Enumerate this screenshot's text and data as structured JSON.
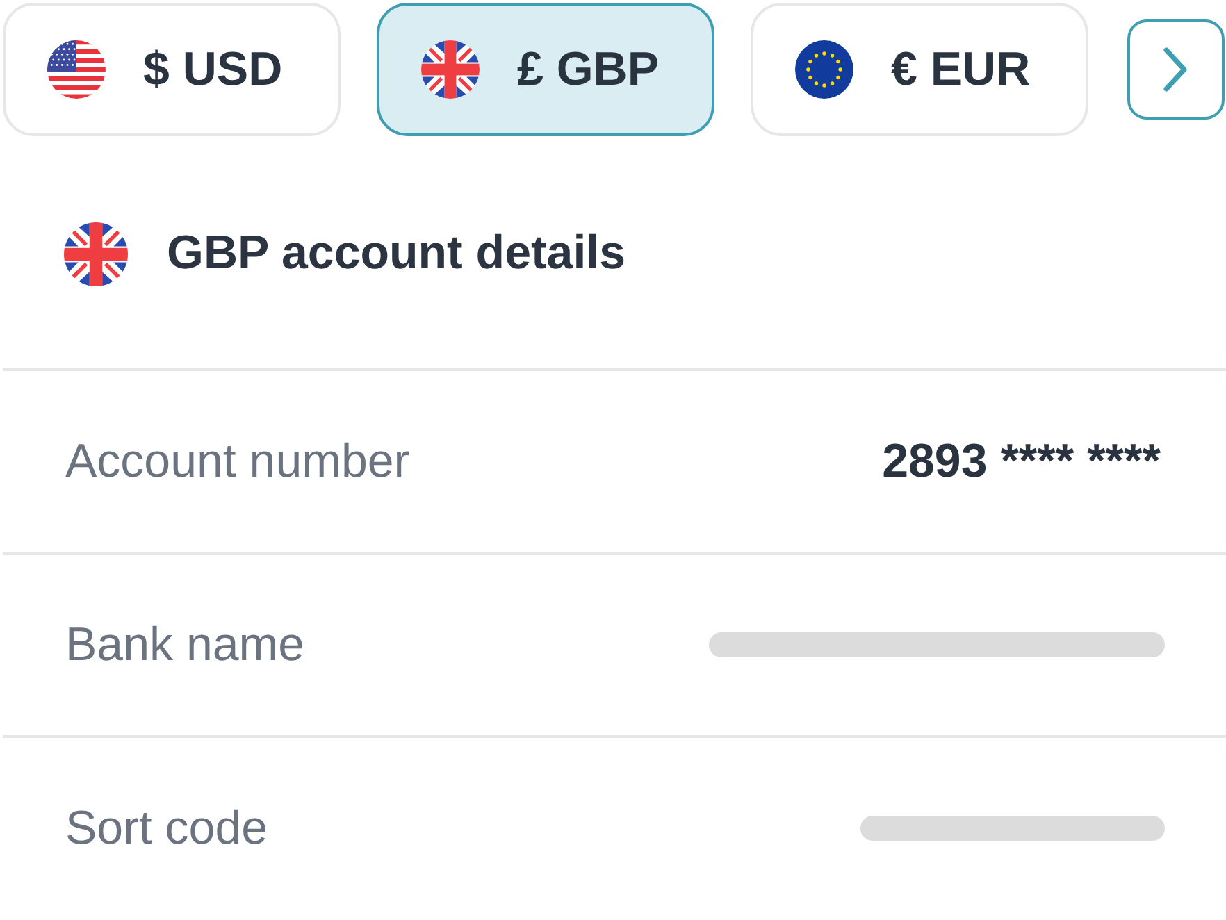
{
  "currency_tabs": [
    {
      "label": "$ USD",
      "kind": "us",
      "selected": false
    },
    {
      "label": "£ GBP",
      "kind": "gb",
      "selected": true
    },
    {
      "label": "€ EUR",
      "kind": "eu",
      "selected": false
    }
  ],
  "account": {
    "title": "GBP account details",
    "kind": "gb",
    "rows": [
      {
        "label": "Account number",
        "kind": "text",
        "value": "2893 **** ****"
      },
      {
        "label": "Bank name",
        "kind": "placeholder"
      },
      {
        "label": "Sort code",
        "kind": "placeholder"
      }
    ]
  }
}
